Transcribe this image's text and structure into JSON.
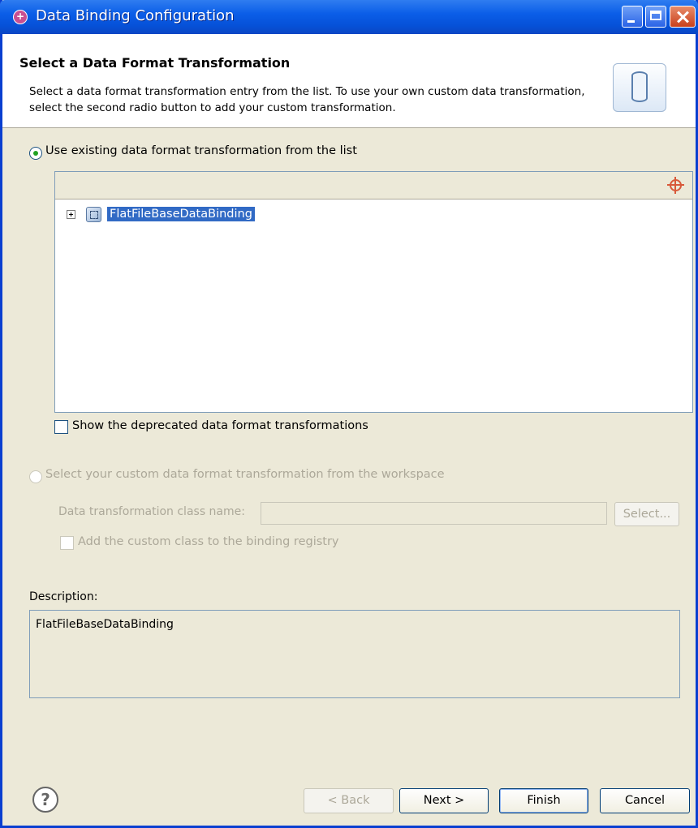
{
  "window": {
    "title": "Data Binding Configuration"
  },
  "header": {
    "title": "Select a Data Format Transformation",
    "description": "Select a data format transformation entry from the list.  To use your own custom data transformation, select the second radio button to add your custom transformation."
  },
  "options": {
    "existing_label": "Use existing data format transformation from the list",
    "existing_selected": true,
    "deprecated_label": "Show the deprecated data format transformations",
    "deprecated_checked": false,
    "custom_label": "Select your custom data format transformation from the workspace",
    "custom_selected": false,
    "class_name_label": "Data transformation class name:",
    "class_name_value": "",
    "select_button": "Select...",
    "registry_label": "Add the custom class to the binding registry",
    "registry_checked": false
  },
  "tree": {
    "items": [
      {
        "label": "FlatFileBaseDataBinding",
        "selected": true,
        "expanded": false
      }
    ]
  },
  "description": {
    "label": "Description:",
    "text": "FlatFileBaseDataBinding"
  },
  "footer": {
    "back": "< Back",
    "next": "Next >",
    "finish": "Finish",
    "cancel": "Cancel"
  },
  "colors": {
    "selection": "#316ac5",
    "titlebar": "#0b5ee8",
    "dialog_bg": "#ece9d8"
  },
  "icons": [
    "app-icon",
    "minimize-icon",
    "maximize-icon",
    "close-icon",
    "database-icon",
    "expand-plus-icon",
    "binding-node-icon",
    "tree-toolbar-icon",
    "help-icon"
  ]
}
